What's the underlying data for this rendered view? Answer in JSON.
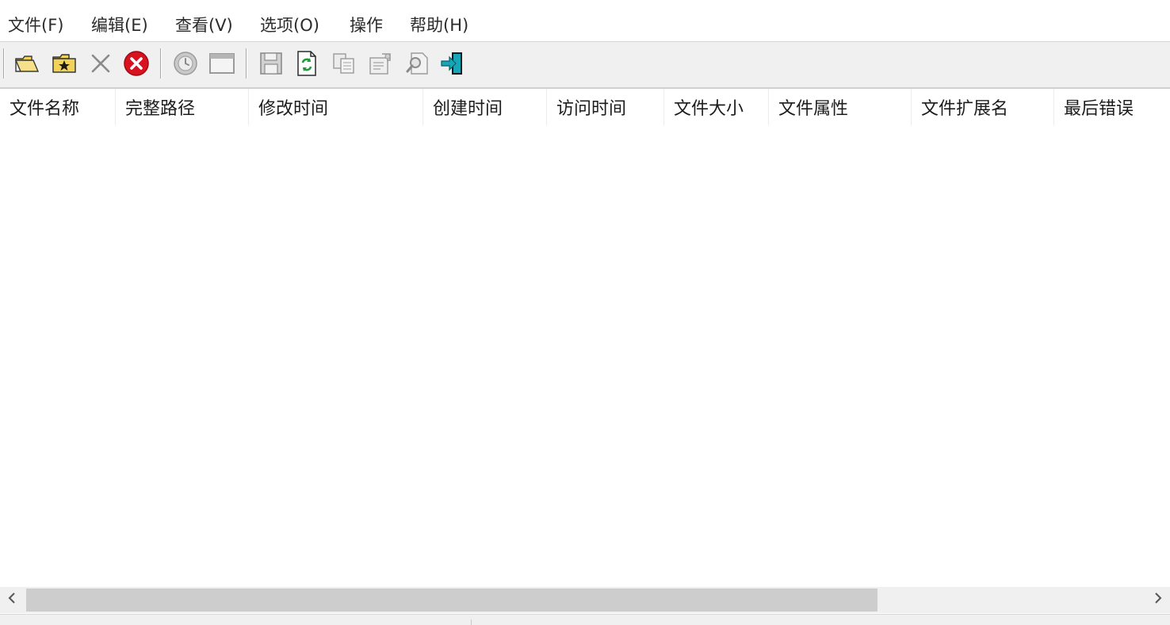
{
  "menu": [
    {
      "label": "文件(F)"
    },
    {
      "label": "编辑(E)"
    },
    {
      "label": "查看(V)"
    },
    {
      "label": "选项(O)"
    },
    {
      "label": "操作"
    },
    {
      "label": "帮助(H)"
    }
  ],
  "toolbar": {
    "buttons": [
      {
        "icon": "open-folder-icon"
      },
      {
        "icon": "favorite-folder-icon"
      },
      {
        "icon": "delete-x-icon"
      },
      {
        "icon": "stop-icon"
      },
      {
        "icon": "clock-icon"
      },
      {
        "icon": "window-icon"
      },
      {
        "icon": "save-icon"
      },
      {
        "icon": "refresh-icon"
      },
      {
        "icon": "copy-icon"
      },
      {
        "icon": "properties-icon"
      },
      {
        "icon": "find-icon"
      },
      {
        "icon": "exit-icon"
      }
    ]
  },
  "columns": [
    {
      "label": "文件名称"
    },
    {
      "label": "完整路径"
    },
    {
      "label": "修改时间"
    },
    {
      "label": "创建时间"
    },
    {
      "label": "访问时间"
    },
    {
      "label": "文件大小"
    },
    {
      "label": "文件属性"
    },
    {
      "label": "文件扩展名"
    },
    {
      "label": "最后错误"
    }
  ],
  "rows": [],
  "colors": {
    "accent_red": "#d9121f",
    "refresh_green": "#1f9a3a",
    "exit_teal": "#17a6b7",
    "folder_yellow": "#f2d35a"
  }
}
